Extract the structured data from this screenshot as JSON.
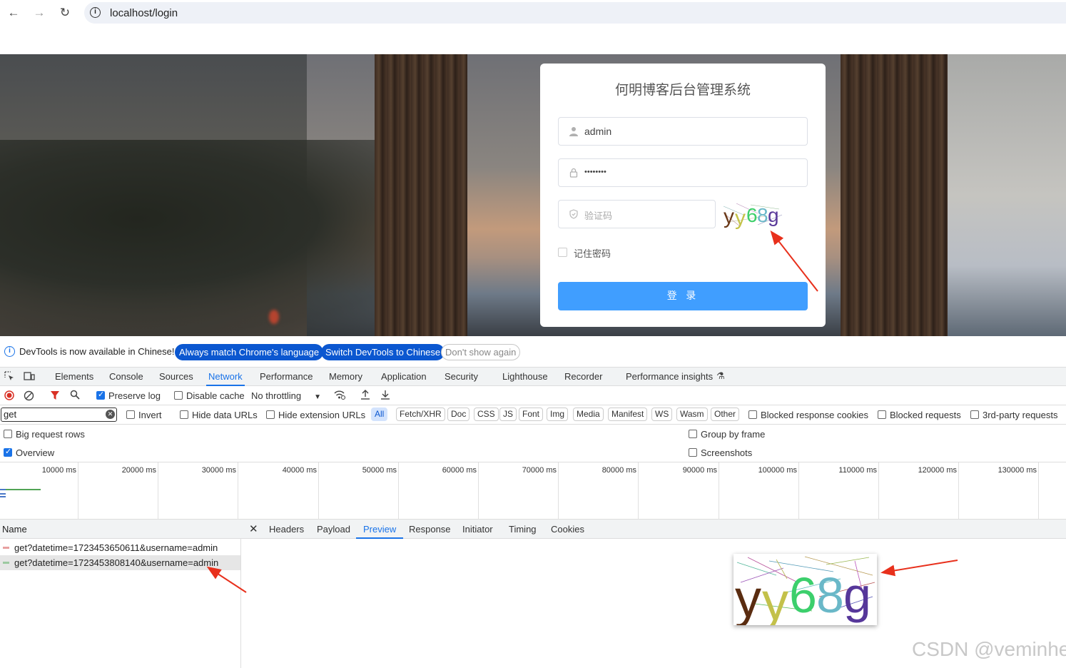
{
  "browser": {
    "url": "localhost/login"
  },
  "login": {
    "title": "何明博客后台管理系统",
    "username_value": "admin",
    "password_value": "••••••••",
    "captcha_placeholder": "验证码",
    "captcha_text": "yy68g",
    "remember_label": "记住密码",
    "login_button": "登 录"
  },
  "devtools": {
    "lang_message": "DevTools is now available in Chinese!",
    "lang_buttons": [
      "Always match Chrome's language",
      "Switch DevTools to Chinese",
      "Don't show again"
    ],
    "tabs": [
      "Elements",
      "Console",
      "Sources",
      "Network",
      "Performance",
      "Memory",
      "Application",
      "Security",
      "Lighthouse",
      "Recorder",
      "Performance insights"
    ],
    "active_tab": "Network",
    "toolbar": {
      "preserve_log": "Preserve log",
      "disable_cache": "Disable cache",
      "throttling": "No throttling"
    },
    "filter": {
      "value": "get",
      "invert": "Invert",
      "hide_data_urls": "Hide data URLs",
      "hide_extension_urls": "Hide extension URLs",
      "types": [
        "All",
        "Fetch/XHR",
        "Doc",
        "CSS",
        "JS",
        "Font",
        "Img",
        "Media",
        "Manifest",
        "WS",
        "Wasm",
        "Other"
      ],
      "blocked_response_cookies": "Blocked response cookies",
      "blocked_requests": "Blocked requests",
      "third_party": "3rd-party requests"
    },
    "options": {
      "big_request_rows": "Big request rows",
      "group_by_frame": "Group by frame",
      "overview": "Overview",
      "screenshots": "Screenshots"
    },
    "timeline_ticks": [
      "10000 ms",
      "20000 ms",
      "30000 ms",
      "40000 ms",
      "50000 ms",
      "60000 ms",
      "70000 ms",
      "80000 ms",
      "90000 ms",
      "100000 ms",
      "110000 ms",
      "120000 ms",
      "130000 ms"
    ],
    "name_header": "Name",
    "requests": [
      "get?datetime=1723453650611&username=admin",
      "get?datetime=1723453808140&username=admin"
    ],
    "detail_tabs": [
      "Headers",
      "Payload",
      "Preview",
      "Response",
      "Initiator",
      "Timing",
      "Cookies"
    ],
    "active_detail_tab": "Preview"
  },
  "watermark": "CSDN @veminhe",
  "colors": {
    "accent": "#1a73e8",
    "login_button": "#409eff",
    "arrow": "#e8301c"
  }
}
